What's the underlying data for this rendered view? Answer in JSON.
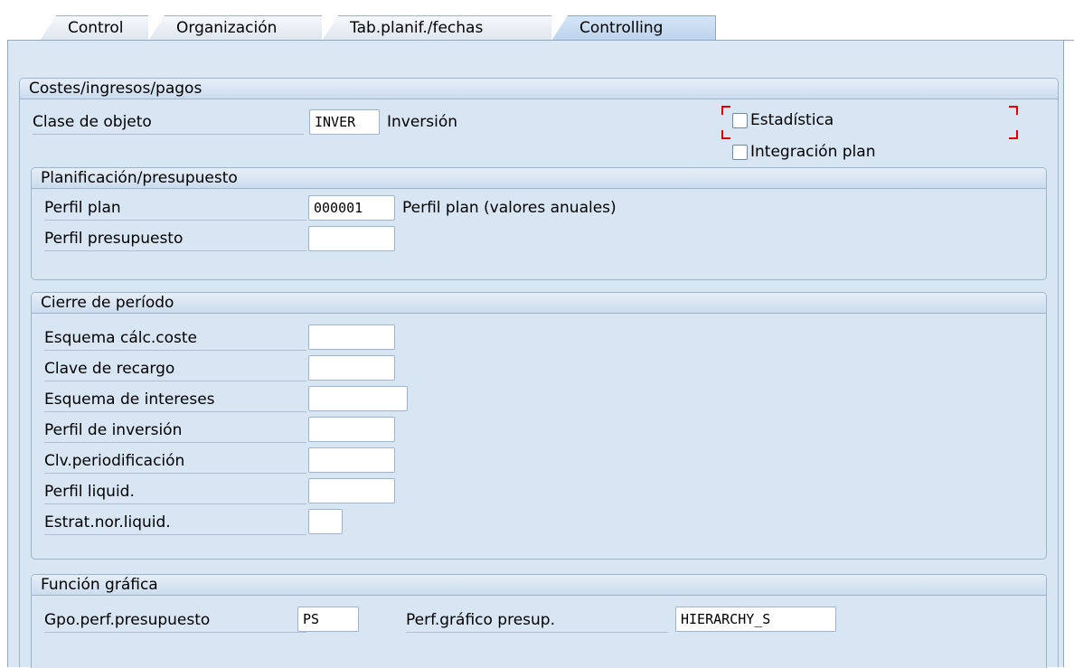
{
  "tabs": [
    {
      "label": "Control",
      "active": false
    },
    {
      "label": "Organización",
      "active": false
    },
    {
      "label": "Tab.planif./fechas",
      "active": false
    },
    {
      "label": "Controlling",
      "active": true
    }
  ],
  "costes": {
    "title": "Costes/ingresos/pagos",
    "clase_objeto_label": "Clase de objeto",
    "clase_objeto_value": "INVER",
    "clase_objeto_desc": "Inversión",
    "estadistica_label": "Estadística",
    "estadistica_checked": false,
    "integracion_label": "Integración plan",
    "integracion_checked": false
  },
  "planificacion": {
    "title": "Planificación/presupuesto",
    "perfil_plan_label": "Perfil plan",
    "perfil_plan_value": "000001",
    "perfil_plan_desc": "Perfil plan (valores anuales)",
    "perfil_presupuesto_label": "Perfil presupuesto",
    "perfil_presupuesto_value": ""
  },
  "cierre": {
    "title": "Cierre de período",
    "fields": [
      {
        "label": "Esquema cálc.coste",
        "value": ""
      },
      {
        "label": "Clave de recargo",
        "value": ""
      },
      {
        "label": "Esquema de intereses",
        "value": ""
      },
      {
        "label": "Perfil de inversión",
        "value": ""
      },
      {
        "label": "Clv.periodificación",
        "value": ""
      },
      {
        "label": "Perfil liquid.",
        "value": ""
      },
      {
        "label": "Estrat.nor.liquid.",
        "value": ""
      }
    ]
  },
  "grafica": {
    "title": "Función gráfica",
    "gpo_label": "Gpo.perf.presupuesto",
    "gpo_value": "PS",
    "perf_label": "Perf.gráfico presup.",
    "perf_value": "HIERARCHY_S"
  },
  "colors": {
    "page_bg": "#dbe8f4",
    "group_border": "#9db4cd",
    "active_tab": "#c4d9ef",
    "focus_marker": "#e00000"
  }
}
